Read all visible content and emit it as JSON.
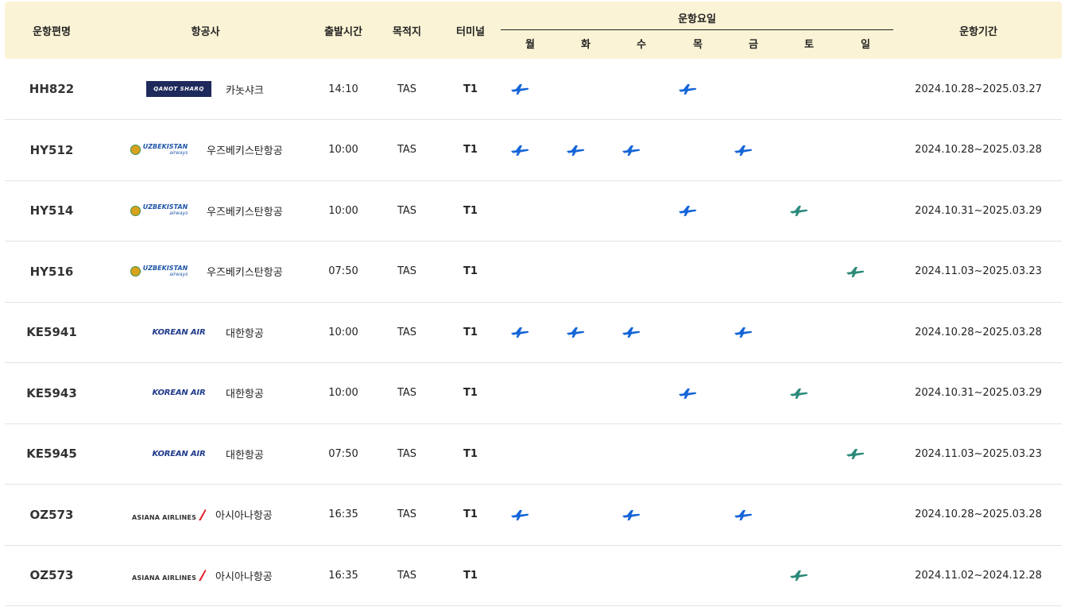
{
  "colors": {
    "header_bg": "#fbf3d5",
    "plane_blue": "#1565d8",
    "plane_green": "#2b8a7a",
    "row_divider": "#e3e3e3"
  },
  "header": {
    "flight_no": "운항편명",
    "airline": "항공사",
    "departure_time": "출발시간",
    "destination": "목적지",
    "terminal": "터미널",
    "days_title": "운항요일",
    "days": [
      "월",
      "화",
      "수",
      "목",
      "금",
      "토",
      "일"
    ],
    "period": "운항기간"
  },
  "rows": [
    {
      "flight": "HH822",
      "logo": "qanot-sharq-logo",
      "logo_text": "QANOT SHARQ",
      "airline": "카놋샤크",
      "time": "14:10",
      "dest": "TAS",
      "terminal": "T1",
      "days": [
        1,
        0,
        0,
        1,
        0,
        0,
        0
      ],
      "period": "2024.10.28~2025.03.27"
    },
    {
      "flight": "HY512",
      "logo": "uzbekistan-airways-logo",
      "logo_text": "UZBEKISTAN",
      "logo_sub": "airways",
      "airline": "우즈베키스탄항공",
      "time": "10:00",
      "dest": "TAS",
      "terminal": "T1",
      "days": [
        1,
        1,
        1,
        0,
        1,
        0,
        0
      ],
      "period": "2024.10.28~2025.03.28"
    },
    {
      "flight": "HY514",
      "logo": "uzbekistan-airways-logo",
      "logo_text": "UZBEKISTAN",
      "logo_sub": "airways",
      "airline": "우즈베키스탄항공",
      "time": "10:00",
      "dest": "TAS",
      "terminal": "T1",
      "days": [
        0,
        0,
        0,
        1,
        0,
        2,
        0
      ],
      "period": "2024.10.31~2025.03.29"
    },
    {
      "flight": "HY516",
      "logo": "uzbekistan-airways-logo",
      "logo_text": "UZBEKISTAN",
      "logo_sub": "airways",
      "airline": "우즈베키스탄항공",
      "time": "07:50",
      "dest": "TAS",
      "terminal": "T1",
      "days": [
        0,
        0,
        0,
        0,
        0,
        0,
        2
      ],
      "period": "2024.11.03~2025.03.23"
    },
    {
      "flight": "KE5941",
      "logo": "korean-air-logo",
      "logo_text": "KOREAN AIR",
      "airline": "대한항공",
      "time": "10:00",
      "dest": "TAS",
      "terminal": "T1",
      "days": [
        1,
        1,
        1,
        0,
        1,
        0,
        0
      ],
      "period": "2024.10.28~2025.03.28"
    },
    {
      "flight": "KE5943",
      "logo": "korean-air-logo",
      "logo_text": "KOREAN AIR",
      "airline": "대한항공",
      "time": "10:00",
      "dest": "TAS",
      "terminal": "T1",
      "days": [
        0,
        0,
        0,
        1,
        0,
        2,
        0
      ],
      "period": "2024.10.31~2025.03.29"
    },
    {
      "flight": "KE5945",
      "logo": "korean-air-logo",
      "logo_text": "KOREAN AIR",
      "airline": "대한항공",
      "time": "07:50",
      "dest": "TAS",
      "terminal": "T1",
      "days": [
        0,
        0,
        0,
        0,
        0,
        0,
        2
      ],
      "period": "2024.11.03~2025.03.23"
    },
    {
      "flight": "OZ573",
      "logo": "asiana-airlines-logo",
      "logo_text": "ASIANA AIRLINES",
      "airline": "아시아나항공",
      "time": "16:35",
      "dest": "TAS",
      "terminal": "T1",
      "days": [
        1,
        0,
        1,
        0,
        1,
        0,
        0
      ],
      "period": "2024.10.28~2025.03.28"
    },
    {
      "flight": "OZ573",
      "logo": "asiana-airlines-logo",
      "logo_text": "ASIANA AIRLINES",
      "airline": "아시아나항공",
      "time": "16:35",
      "dest": "TAS",
      "terminal": "T1",
      "days": [
        0,
        0,
        0,
        0,
        0,
        2,
        0
      ],
      "period": "2024.11.02~2024.12.28"
    }
  ]
}
